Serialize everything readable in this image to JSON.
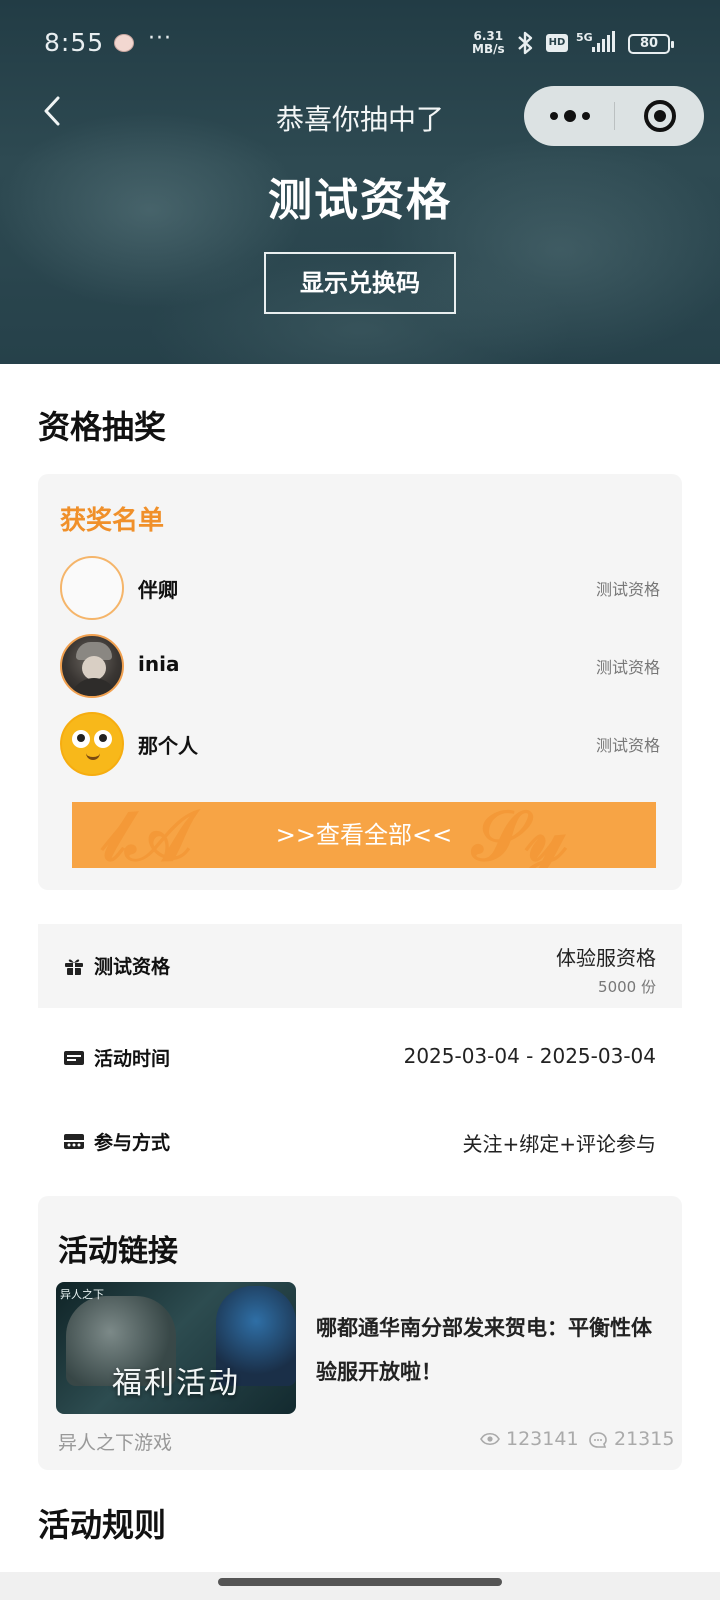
{
  "status_bar": {
    "time": "8:55",
    "dots": "···",
    "net_speed_value": "6.31",
    "net_speed_unit": "MB/s",
    "hd": "HD",
    "network": "5G",
    "battery": "80"
  },
  "header": {
    "congrats": "恭喜你抽中了",
    "prize": "测试资格",
    "redeem_button": "显示兑换码"
  },
  "lottery": {
    "section_title": "资格抽奖",
    "winners_heading": "获奖名单",
    "winners": [
      {
        "name": "伴卿",
        "prize": "测试资格"
      },
      {
        "name": "inia",
        "prize": "测试资格"
      },
      {
        "name": "那个人",
        "prize": "测试资格"
      }
    ],
    "view_all": ">>查看全部<<"
  },
  "details": {
    "prize": {
      "label": "测试资格",
      "value": "体验服资格",
      "quantity": "5000 份"
    },
    "time": {
      "label": "活动时间",
      "value": "2025-03-04 - 2025-03-04"
    },
    "method": {
      "label": "参与方式",
      "value": "关注+绑定+评论参与"
    }
  },
  "links": {
    "heading": "活动链接",
    "thumbnail_corner": "异人之下",
    "thumbnail_caption": "福利活动",
    "article_title": "哪都通华南分部发来贺电：平衡性体验服开放啦！",
    "source": "异人之下游戏",
    "views": "123141",
    "comments": "21315"
  },
  "rules": {
    "section_title": "活动规则"
  },
  "colors": {
    "accent": "#f0902a",
    "button_orange": "#f7a445",
    "header_bg": "#2e4a52"
  }
}
